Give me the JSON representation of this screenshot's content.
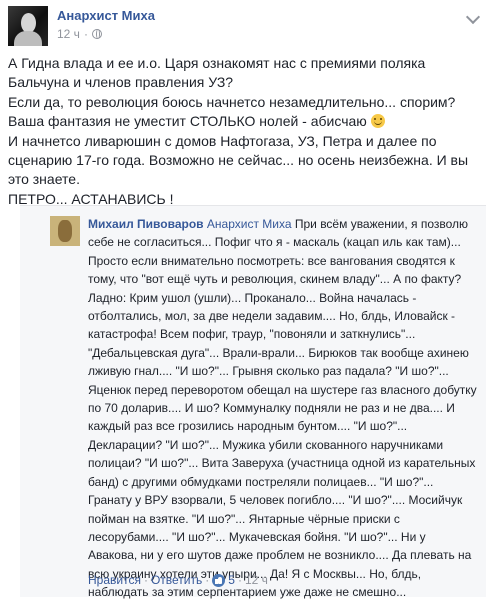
{
  "post": {
    "author": "Анархист Миха",
    "time": "12 ч",
    "body": [
      "А Гидна влада и ее и.о. Царя ознакомят нас с премиями поляка Бальчуна и членов правления УЗ?",
      "Если да, то революция боюсь начнетсо незамедлительно... спорим?",
      "Ваша фантазия не уместит СТОЛЬКО нолей - абисчаю",
      "И начнетсо ливарюшин с домов Нафтогаза, УЗ, Петра и далее по сценарию 17-го года. Возможно не сейчас... но осень неизбежна. И вы это знаете.",
      "ПЕТРО... АСТАНАВИСЬ !"
    ]
  },
  "comment": {
    "author": "Михаил Пивоваров",
    "mention": "Анархист Миха",
    "text": "При всём уважении, я позволю себе не согласиться... Пофиг что я - маскаль (кацап иль как там)... Просто если внимательно посмотреть: все вангования сводятся к тому, что \"вот ещё чуть и революция, скинем владу\"... А по факту? Ладно: Крим ушол (ушли)... Проканало... Война началась - отболтались, мол, за две недели задавим.... Но, блдь, Иловайск - катастрофа! Всем пофиг, траур, \"повоняли и заткнулись\"... \"Дебальцевская дуга\"... Врали-врали... Бирюков так вообще ахинею лживую гнал.... \"И шо?\"... Грывня сколько раз падала? \"И шо?\"... Яценюк перед переворотом обещал на шустере газ власного добутку по 70 доларив.... И шо? Коммуналку подняли не раз и не два.... И каждый раз все грозились народным бунтом.... \"И шо?\"... Декларации? \"И шо?\"... Мужика убили скованного наручниками полицаи? \"И шо?\"... Вита Заверуха (участница одной из карательных банд) с другими обмудками постреляли полицаев... \"И шо?\"... Гранату у ВРУ взорвали, 5 человек погибло.... \"И шо?\".... Мосийчук пойман на взятке. \"И шо?\"... Янтарные чёрные приски с лесорубами.... \"И шо?\"... Мукачевская бойня. \"И шо?\"... Ни у Авакова, ни у его шутов даже проблем не возникло.... Да плевать на всю украину хотели эти упыри... Да! Я с Москвы... Но, блдь, наблюдать за этим серпентарием уже даже не смешно...",
    "like_label": "Нравится",
    "reply_label": "Ответить",
    "like_count": "5",
    "time": "12 ч"
  }
}
